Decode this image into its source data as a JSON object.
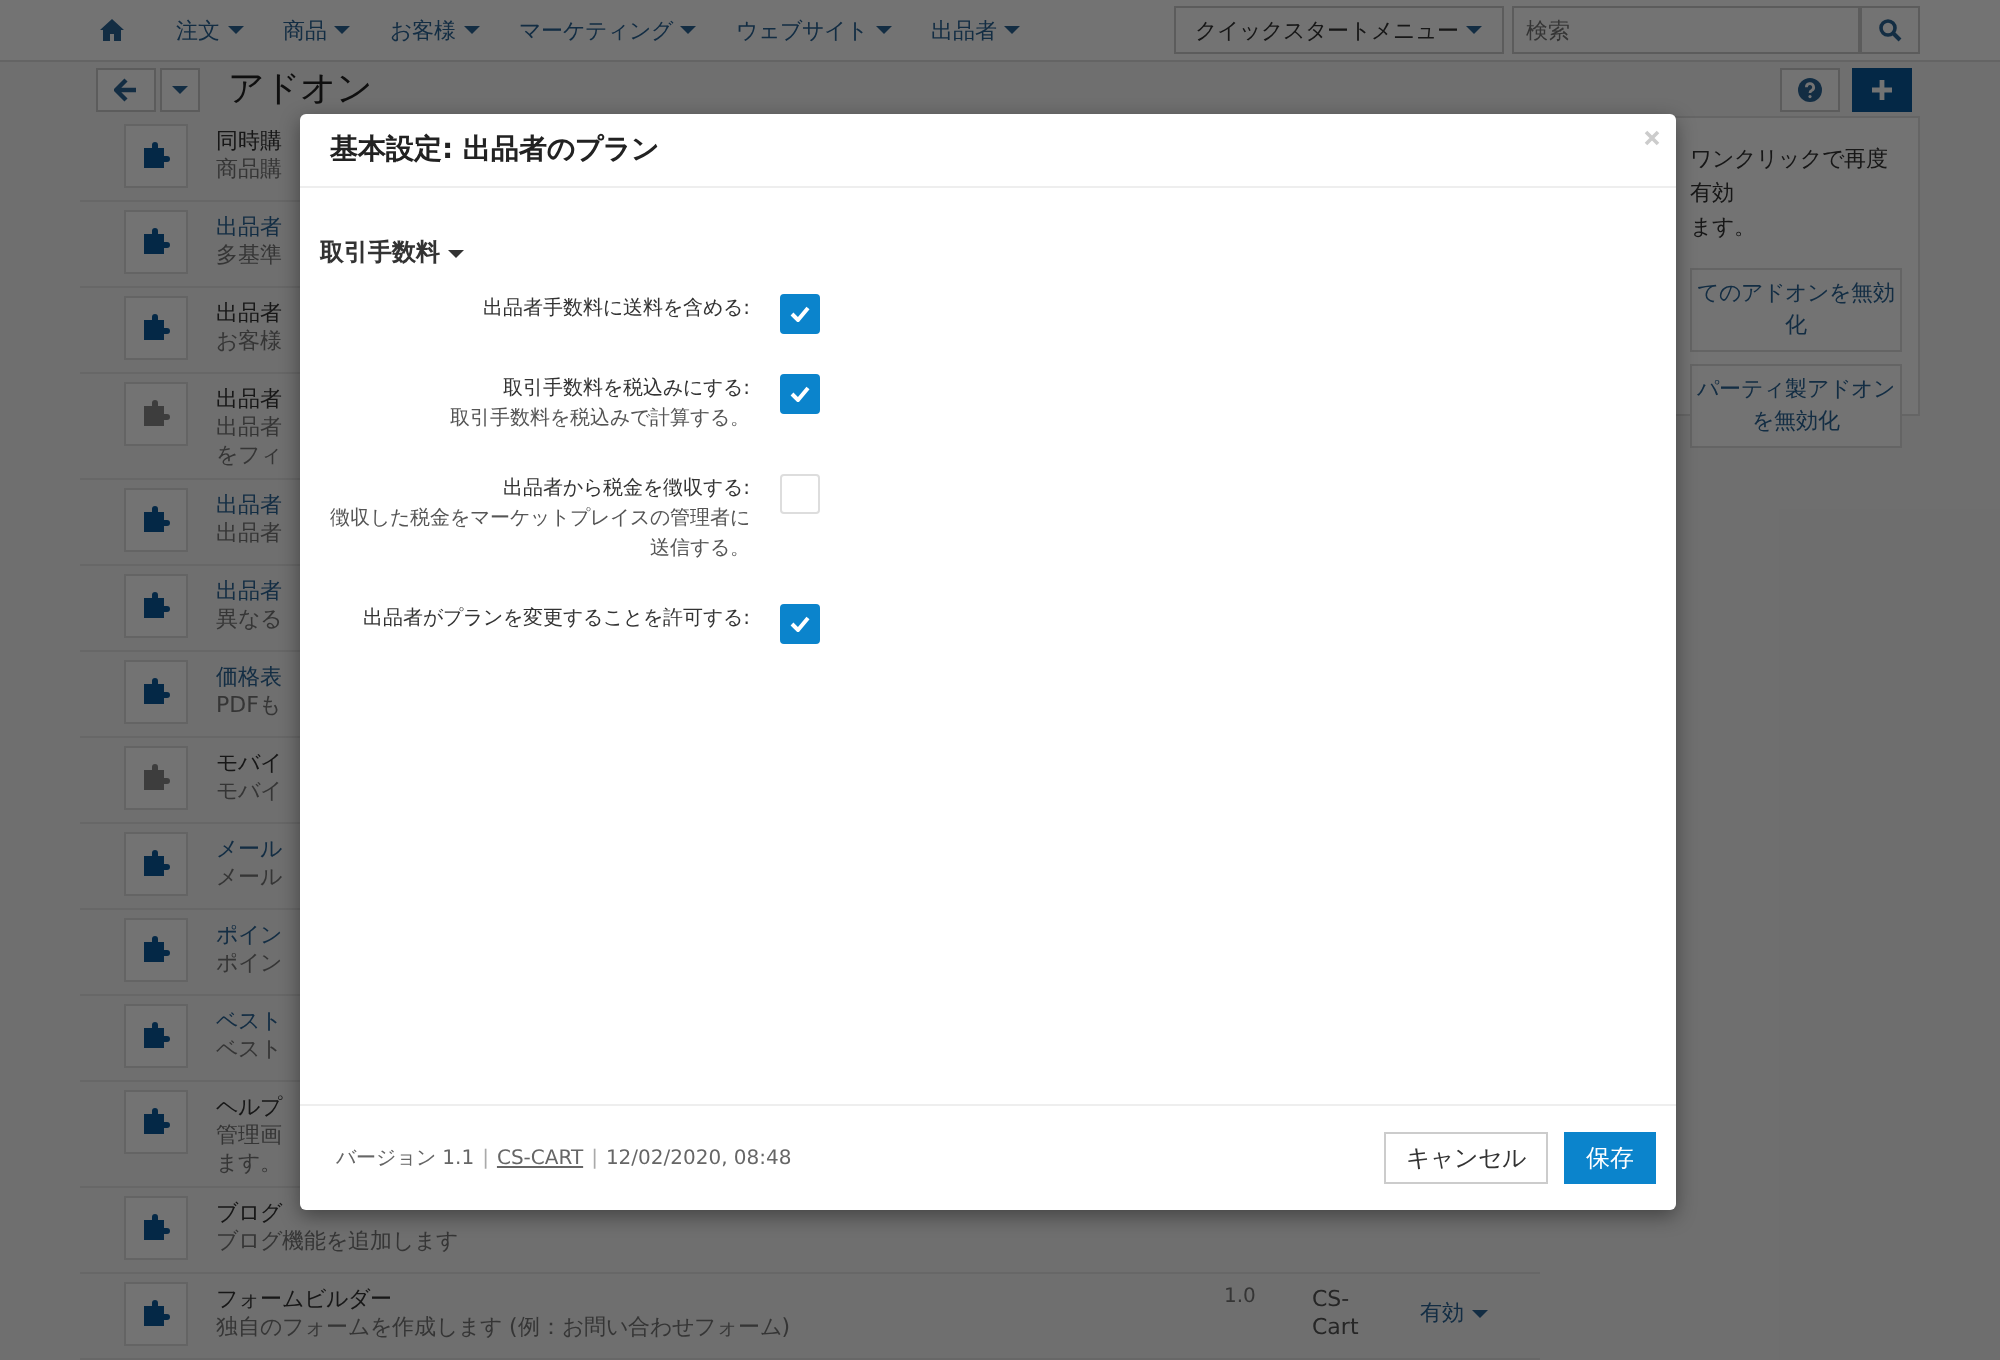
{
  "nav": {
    "menus": [
      {
        "label": "注文"
      },
      {
        "label": "商品"
      },
      {
        "label": "お客様"
      },
      {
        "label": "マーケティング"
      },
      {
        "label": "ウェブサイト"
      },
      {
        "label": "出品者"
      }
    ],
    "quickstart": "クイックスタートメニュー",
    "search": {
      "placeholder": "検索"
    }
  },
  "toolbar": {
    "title": "アドオン"
  },
  "addons": [
    {
      "title": "同時購",
      "desc": [
        "商品購"
      ],
      "linked": false,
      "enabled": true
    },
    {
      "title": "出品者",
      "desc": [
        "多基準"
      ],
      "linked": true,
      "enabled": true
    },
    {
      "title": "出品者",
      "desc": [
        "お客様"
      ],
      "linked": false,
      "enabled": true
    },
    {
      "title": "出品者",
      "desc": [
        "出品者",
        "をフィ"
      ],
      "linked": false,
      "enabled": false
    },
    {
      "title": "出品者",
      "desc": [
        "出品者"
      ],
      "linked": true,
      "enabled": true
    },
    {
      "title": "出品者",
      "desc": [
        "異なる"
      ],
      "linked": true,
      "enabled": true
    },
    {
      "title": "価格表",
      "desc": [
        "PDFも"
      ],
      "linked": true,
      "enabled": true
    },
    {
      "title": "モバイ",
      "desc": [
        "モバイ"
      ],
      "linked": false,
      "enabled": false
    },
    {
      "title": "メール",
      "desc": [
        "メール"
      ],
      "linked": true,
      "enabled": true
    },
    {
      "title": "ポイン",
      "desc": [
        "ポイン"
      ],
      "linked": true,
      "enabled": true
    },
    {
      "title": "ベスト",
      "desc": [
        "ベスト"
      ],
      "linked": true,
      "enabled": true
    },
    {
      "title": "ヘルプ",
      "desc": [
        "管理画",
        "ます。"
      ],
      "linked": false,
      "enabled": true
    },
    {
      "title": "ブログ",
      "desc": [
        "ブログ機能を追加します"
      ],
      "linked": false,
      "enabled": true
    },
    {
      "title": "フォームビルダー",
      "desc": [
        "独自のフォームを作成します (例：お問い合わせフォーム)"
      ],
      "linked": false,
      "enabled": true,
      "version": "1.0",
      "provider": "CS-Cart",
      "status": "有効"
    }
  ],
  "sidebar": {
    "text": [
      "ワンクリックで再度有効",
      "ます。"
    ],
    "buttons": [
      "てのアドオンを無効化",
      "パーティ製アドオンを無効化"
    ]
  },
  "modal": {
    "title": "基本設定: 出品者のプラン",
    "section": "取引手数料",
    "settings": [
      {
        "label": "出品者手数料に送料を含める:",
        "checked": true
      },
      {
        "label": "取引手数料を税込みにする:",
        "help": "取引手数料を税込みで計算する。",
        "checked": true
      },
      {
        "label": "出品者から税金を徴収する:",
        "help": "徴収した税金をマーケットプレイスの管理者に送信する。",
        "checked": false
      },
      {
        "label": "出品者がプランを変更することを許可する:",
        "checked": true
      }
    ],
    "footer": [
      {
        "kind": "text",
        "text": "バージョン 1.1"
      },
      {
        "kind": "separator",
        "text": "|"
      },
      {
        "kind": "link",
        "text": "CS-CART"
      },
      {
        "kind": "separator",
        "text": "|"
      },
      {
        "kind": "text",
        "text": "12/02/2020, 08:48"
      }
    ],
    "cancel": "キャンセル",
    "save": "保存"
  }
}
